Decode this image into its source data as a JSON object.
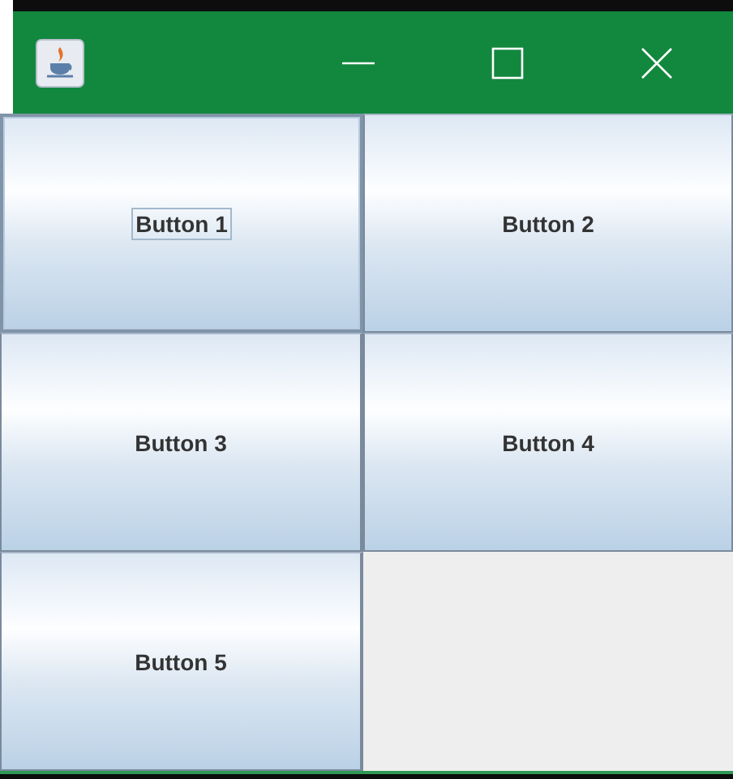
{
  "window": {
    "buttons": [
      {
        "label": "Button 1",
        "focused": true
      },
      {
        "label": "Button 2",
        "focused": false
      },
      {
        "label": "Button 3",
        "focused": false
      },
      {
        "label": "Button 4",
        "focused": false
      },
      {
        "label": "Button 5",
        "focused": false
      }
    ]
  }
}
